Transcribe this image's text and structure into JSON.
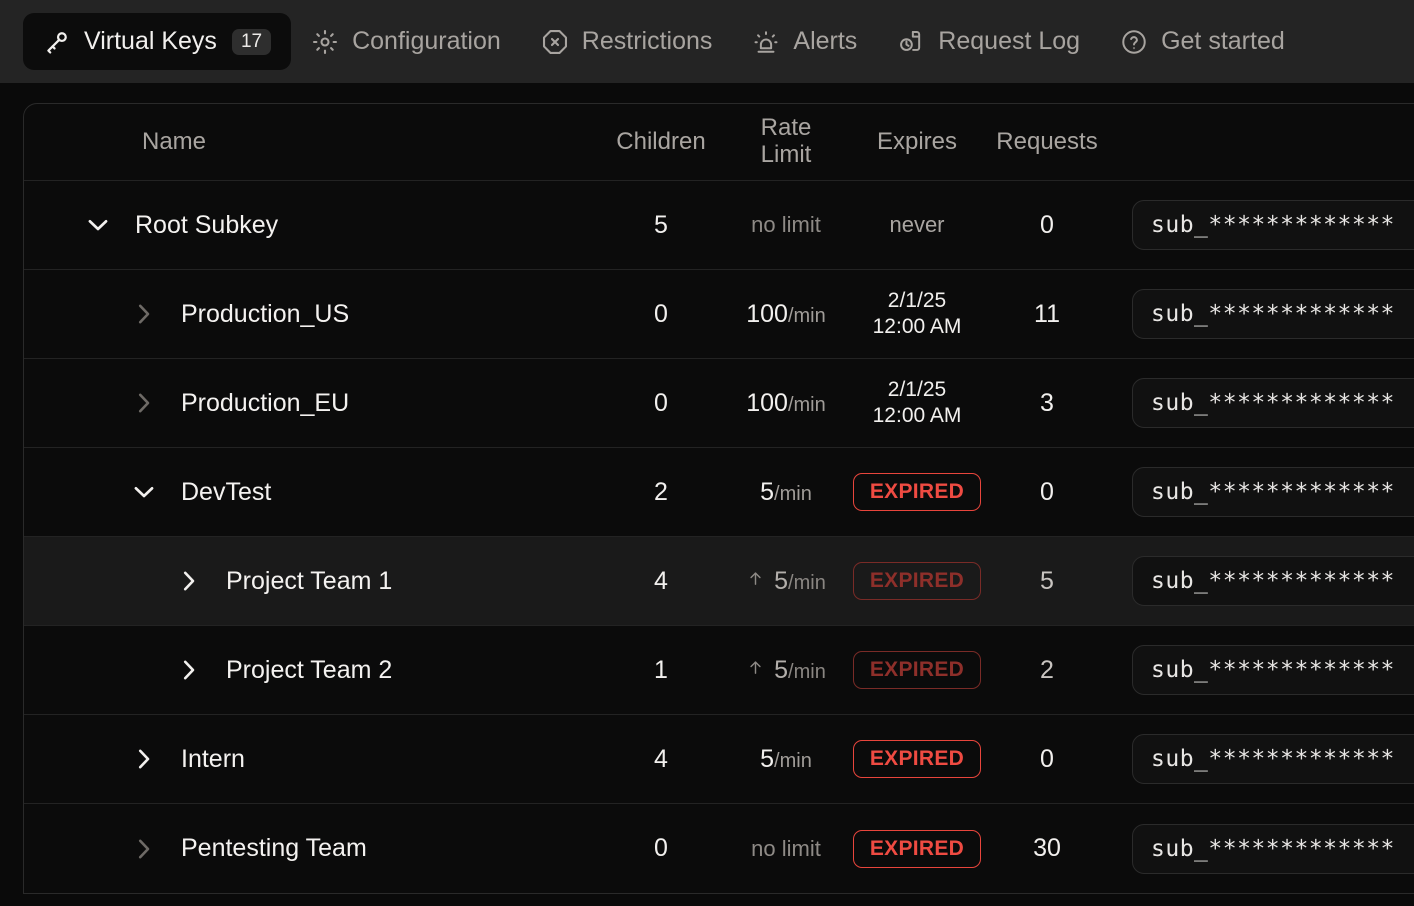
{
  "tabs": [
    {
      "label": "Virtual Keys",
      "icon": "key-icon",
      "count": "17",
      "active": true
    },
    {
      "label": "Configuration",
      "icon": "gear-icon",
      "count": null,
      "active": false
    },
    {
      "label": "Restrictions",
      "icon": "octagon-x-icon",
      "count": null,
      "active": false
    },
    {
      "label": "Alerts",
      "icon": "siren-icon",
      "count": null,
      "active": false
    },
    {
      "label": "Request Log",
      "icon": "document-clock-icon",
      "count": null,
      "active": false
    },
    {
      "label": "Get started",
      "icon": "question-circle-icon",
      "count": null,
      "active": false
    }
  ],
  "table": {
    "headers": {
      "name": "Name",
      "children": "Children",
      "rate_limit_line1": "Rate",
      "rate_limit_line2": "Limit",
      "expires": "Expires",
      "requests": "Requests"
    },
    "rows": [
      {
        "name": "Root Subkey",
        "depth": 0,
        "expanded": true,
        "chevron": "chevron-down-icon",
        "chevron_dim": false,
        "children": "5",
        "rate_limit": {
          "text": "no limit",
          "kind": "none",
          "inherited": false
        },
        "expires": {
          "kind": "never",
          "text": "never"
        },
        "requests": "0",
        "key": "sub_*************",
        "hovered": false,
        "muted": false
      },
      {
        "name": "Production_US",
        "depth": 1,
        "expanded": false,
        "chevron": "chevron-right-icon",
        "chevron_dim": true,
        "children": "0",
        "rate_limit": {
          "number": "100",
          "unit": "/min",
          "kind": "value",
          "inherited": false
        },
        "expires": {
          "kind": "date",
          "line1": "2/1/25",
          "line2": "12:00 AM"
        },
        "requests": "11",
        "key": "sub_*************",
        "hovered": false,
        "muted": false
      },
      {
        "name": "Production_EU",
        "depth": 1,
        "expanded": false,
        "chevron": "chevron-right-icon",
        "chevron_dim": true,
        "children": "0",
        "rate_limit": {
          "number": "100",
          "unit": "/min",
          "kind": "value",
          "inherited": false
        },
        "expires": {
          "kind": "date",
          "line1": "2/1/25",
          "line2": "12:00 AM"
        },
        "requests": "3",
        "key": "sub_*************",
        "hovered": false,
        "muted": false
      },
      {
        "name": "DevTest",
        "depth": 1,
        "expanded": true,
        "chevron": "chevron-down-icon",
        "chevron_dim": false,
        "children": "2",
        "rate_limit": {
          "number": "5",
          "unit": "/min",
          "kind": "value",
          "inherited": false
        },
        "expires": {
          "kind": "expired",
          "text": "EXPIRED"
        },
        "requests": "0",
        "key": "sub_*************",
        "hovered": false,
        "muted": false
      },
      {
        "name": "Project Team 1",
        "depth": 2,
        "expanded": false,
        "chevron": "chevron-right-icon",
        "chevron_dim": false,
        "children": "4",
        "rate_limit": {
          "number": "5",
          "unit": "/min",
          "kind": "value",
          "inherited": true,
          "inherit_icon": "arrow-up-icon"
        },
        "expires": {
          "kind": "expired",
          "text": "EXPIRED"
        },
        "requests": "5",
        "key": "sub_*************",
        "hovered": true,
        "muted": true
      },
      {
        "name": "Project Team 2",
        "depth": 2,
        "expanded": false,
        "chevron": "chevron-right-icon",
        "chevron_dim": false,
        "children": "1",
        "rate_limit": {
          "number": "5",
          "unit": "/min",
          "kind": "value",
          "inherited": true,
          "inherit_icon": "arrow-up-icon"
        },
        "expires": {
          "kind": "expired",
          "text": "EXPIRED"
        },
        "requests": "2",
        "key": "sub_*************",
        "hovered": false,
        "muted": true
      },
      {
        "name": "Intern",
        "depth": 1,
        "expanded": false,
        "chevron": "chevron-right-icon",
        "chevron_dim": false,
        "children": "4",
        "rate_limit": {
          "number": "5",
          "unit": "/min",
          "kind": "value",
          "inherited": false
        },
        "expires": {
          "kind": "expired",
          "text": "EXPIRED"
        },
        "requests": "0",
        "key": "sub_*************",
        "hovered": false,
        "muted": false
      },
      {
        "name": "Pentesting Team",
        "depth": 1,
        "expanded": false,
        "chevron": "chevron-right-icon",
        "chevron_dim": true,
        "children": "0",
        "rate_limit": {
          "text": "no limit",
          "kind": "none",
          "inherited": false
        },
        "expires": {
          "kind": "expired",
          "text": "EXPIRED"
        },
        "requests": "30",
        "key": "sub_*************",
        "hovered": false,
        "muted": false
      }
    ]
  },
  "colors": {
    "tabbar_bg": "#242424",
    "active_tab_bg": "#0c0c0c",
    "table_bg": "#0b0b0b",
    "row_hover_bg": "#1a1a1a",
    "border": "#232323",
    "text_primary": "#f2f0ee",
    "text_muted": "#a9a5a1",
    "expired_red": "#ef4b42",
    "expired_red_dim": "#8e2f2a"
  }
}
